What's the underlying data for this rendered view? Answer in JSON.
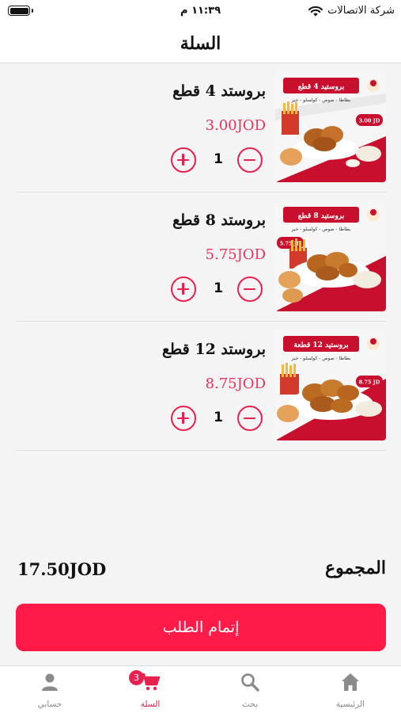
{
  "status_bar": {
    "time": "١١:٣٩ م",
    "carrier": "شركة الاتصالات",
    "battery_level": 1.0
  },
  "header": {
    "title": "السلة"
  },
  "cart": {
    "items": [
      {
        "name": "بروستد 4 قطع",
        "price": "3.00JOD",
        "quantity": "1",
        "image": {
          "title": "بروستيد 4 قطع",
          "subtitle": "بطاطا - صوص - كولسلو - خبز",
          "price_badge": "3.00 JD"
        }
      },
      {
        "name": "بروستد 8 قطع",
        "price": "5.75JOD",
        "quantity": "1",
        "image": {
          "title": "بروستيد 8 قطع",
          "subtitle": "بطاطا - صوص - كولسلو - خبز",
          "price_badge": "5.75 JD"
        }
      },
      {
        "name": "بروستد 12 قطع",
        "price": "8.75JOD",
        "quantity": "1",
        "image": {
          "title": "بروستيد 12 قطعة",
          "subtitle": "بطاطا - صوص - كولسلو - خبز",
          "price_badge": "8.75 JD"
        }
      }
    ]
  },
  "summary": {
    "total_label": "المجموع",
    "total_value": "17.50JOD"
  },
  "checkout": {
    "label": "إتمام الطلب"
  },
  "tabs": [
    {
      "label": "حسابي",
      "icon": "person-icon",
      "active": false
    },
    {
      "label": "السلة",
      "icon": "cart-icon",
      "active": true,
      "badge": "3"
    },
    {
      "label": "بحث",
      "icon": "search-icon",
      "active": false
    },
    {
      "label": "الرئيسية",
      "icon": "home-icon",
      "active": false
    }
  ],
  "colors": {
    "accent": "#e8204f",
    "button": "#ff1a47",
    "price": "#e8325a",
    "banner": "#c8102e"
  }
}
